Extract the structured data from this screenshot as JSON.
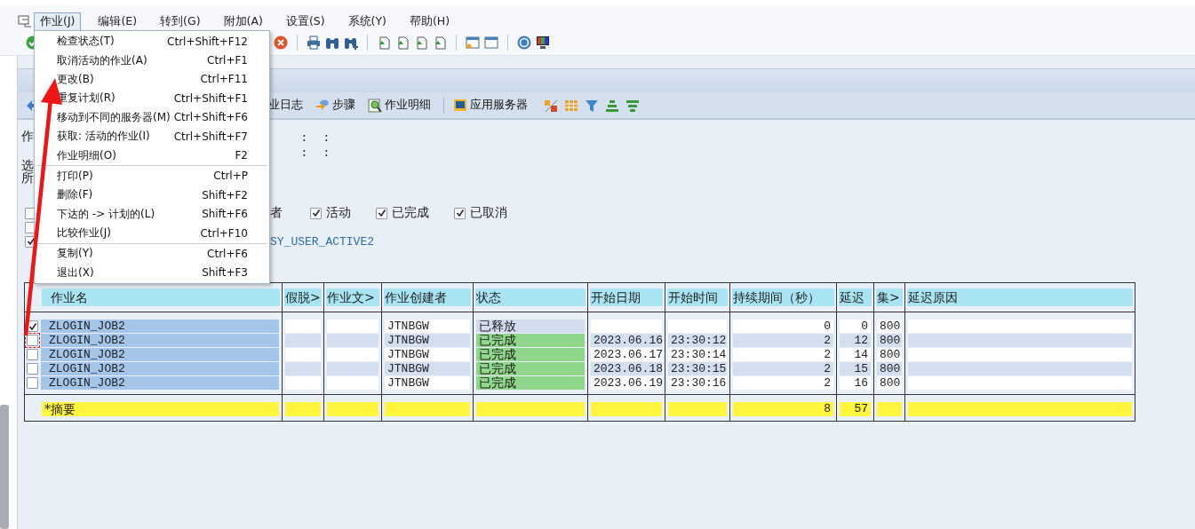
{
  "menubar": [
    {
      "label": "作业(J)",
      "selected": true
    },
    {
      "label": "编辑(E)",
      "selected": false
    },
    {
      "label": "转到(G)",
      "selected": false
    },
    {
      "label": "附加(A)",
      "selected": false
    },
    {
      "label": "设置(S)",
      "selected": false
    },
    {
      "label": "系统(Y)",
      "selected": false
    },
    {
      "label": "帮助(H)",
      "selected": false
    }
  ],
  "job_menu": [
    {
      "items": [
        {
          "label": "检查状态(T)",
          "shortcut": "Ctrl+Shift+F12"
        },
        {
          "label": "取消活动的作业(A)",
          "shortcut": "Ctrl+F1"
        },
        {
          "label": "更改(B)",
          "shortcut": "Ctrl+F11"
        },
        {
          "label": "重复计划(R)",
          "shortcut": "Ctrl+Shift+F1"
        },
        {
          "label": "移动到不同的服务器(M)",
          "shortcut": "Ctrl+Shift+F6"
        },
        {
          "label": "获取: 活动的作业(I)",
          "shortcut": "Ctrl+Shift+F7"
        },
        {
          "label": "作业明细(O)",
          "shortcut": "F2"
        }
      ]
    },
    {
      "items": [
        {
          "label": "打印(P)",
          "shortcut": "Ctrl+P"
        },
        {
          "label": "删除(F)",
          "shortcut": "Shift+F2"
        },
        {
          "label": "下达的 -> 计划的(L)",
          "shortcut": "Shift+F6"
        },
        {
          "label": "比较作业(J)",
          "shortcut": "Ctrl+F10"
        }
      ]
    },
    {
      "items": [
        {
          "label": "复制(Y)",
          "shortcut": "Ctrl+F6"
        },
        {
          "label": "退出(X)",
          "shortcut": "Shift+F3"
        }
      ]
    }
  ],
  "app_toolbar": [
    {
      "label": "业日志",
      "kind": "text"
    },
    {
      "label": "步骤",
      "kind": "steps"
    },
    {
      "label": "作业明细",
      "kind": "details"
    },
    {
      "label": "应用服务器",
      "kind": "server"
    }
  ],
  "header_lines": [
    {
      "label": "作",
      "colons": [
        ":",
        ":"
      ]
    },
    {
      "colons": [
        ":",
        ":"
      ]
    }
  ],
  "selection_lines": [
    "选",
    "所"
  ],
  "filter_rows": [
    {
      "checked": false,
      "tail_text": "者",
      "options": [
        {
          "label": "活动",
          "checked": true
        },
        {
          "label": "已完成",
          "checked": true
        },
        {
          "label": "已取消",
          "checked": true
        }
      ]
    },
    {
      "checked": false
    },
    {
      "checked": true,
      "value": "SY_USER_ACTIVE2"
    }
  ],
  "table": {
    "columns": [
      "作业名",
      "假脱>",
      "作业文>",
      "作业创建者",
      "状态",
      "开始日期",
      "开始时间",
      "持续期间（秒）",
      "延迟",
      "集>",
      "延迟原因"
    ],
    "rows": [
      {
        "checked": true,
        "marked": false,
        "job_name": "ZLOGIN_JOB2",
        "created_by": "JTNBGW",
        "status": "已释放",
        "color": "#d3dcee",
        "duration": "0",
        "delay": "0",
        "client": "800"
      },
      {
        "checked": false,
        "marked": true,
        "job_name": "ZLOGIN_JOB2",
        "created_by": "JTNBGW",
        "status": "已完成",
        "color": "#8fd68a",
        "start_date": "2023.06.16",
        "start_time": "23:30:12",
        "duration": "2",
        "delay": "12",
        "client": "800"
      },
      {
        "checked": false,
        "marked": false,
        "job_name": "ZLOGIN_JOB2",
        "created_by": "JTNBGW",
        "status": "已完成",
        "color": "#8fd68a",
        "start_date": "2023.06.17",
        "start_time": "23:30:14",
        "duration": "2",
        "delay": "14",
        "client": "800"
      },
      {
        "checked": false,
        "marked": false,
        "job_name": "ZLOGIN_JOB2",
        "created_by": "JTNBGW",
        "status": "已完成",
        "color": "#8fd68a",
        "start_date": "2023.06.18",
        "start_time": "23:30:15",
        "duration": "2",
        "delay": "15",
        "client": "800"
      },
      {
        "checked": false,
        "marked": false,
        "job_name": "ZLOGIN_JOB2",
        "created_by": "JTNBGW",
        "status": "已完成",
        "color": "#8fd68a",
        "start_date": "2023.06.19",
        "start_time": "23:30:16",
        "duration": "2",
        "delay": "16",
        "client": "800"
      }
    ],
    "summary": {
      "label": "*摘要",
      "duration": "8",
      "delay": "57"
    }
  }
}
